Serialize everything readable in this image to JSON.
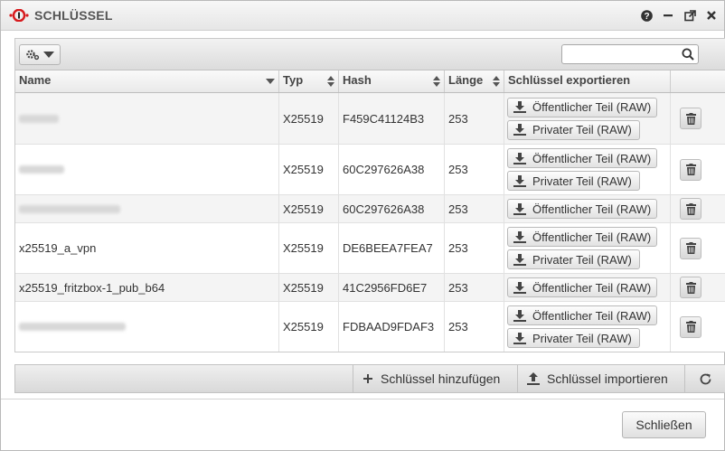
{
  "window": {
    "title": "SCHLÜSSEL"
  },
  "toolbar": {
    "search_placeholder": ""
  },
  "columns": [
    "Name",
    "Typ",
    "Hash",
    "Länge",
    "Schlüssel exportieren"
  ],
  "rows": [
    {
      "name": "",
      "typ": "X25519",
      "hash": "F459C41124B3",
      "laenge": "253",
      "public": "Öffentlicher Teil (RAW)",
      "private": "Privater Teil (RAW)"
    },
    {
      "name": "",
      "typ": "X25519",
      "hash": "60C297626A38",
      "laenge": "253",
      "public": "Öffentlicher Teil (RAW)",
      "private": "Privater Teil (RAW)"
    },
    {
      "name": "",
      "typ": "X25519",
      "hash": "60C297626A38",
      "laenge": "253",
      "public": "Öffentlicher Teil (RAW)"
    },
    {
      "name": "x25519_a_vpn",
      "typ": "X25519",
      "hash": "DE6BEEA7FEA7",
      "laenge": "253",
      "public": "Öffentlicher Teil (RAW)",
      "private": "Privater Teil (RAW)"
    },
    {
      "name": "x25519_fritzbox-1_pub_b64",
      "typ": "X25519",
      "hash": "41C2956FD6E7",
      "laenge": "253",
      "public": "Öffentlicher Teil (RAW)"
    },
    {
      "name": "",
      "typ": "X25519",
      "hash": "FDBAAD9FDAF3",
      "laenge": "253",
      "public": "Öffentlicher Teil (RAW)",
      "private": "Privater Teil (RAW)"
    }
  ],
  "footer": {
    "add_label": "Schlüssel hinzufügen",
    "import_label": "Schlüssel importieren",
    "close_label": "Schließen"
  },
  "colors": {
    "brand_red": "#d7191c",
    "accent_dark": "#333333"
  },
  "icons": [
    "help-icon",
    "minimize-icon",
    "external-link-icon",
    "close-icon",
    "gear-icon",
    "search-icon",
    "download-icon",
    "trash-icon",
    "plus-icon",
    "upload-icon",
    "refresh-icon"
  ]
}
